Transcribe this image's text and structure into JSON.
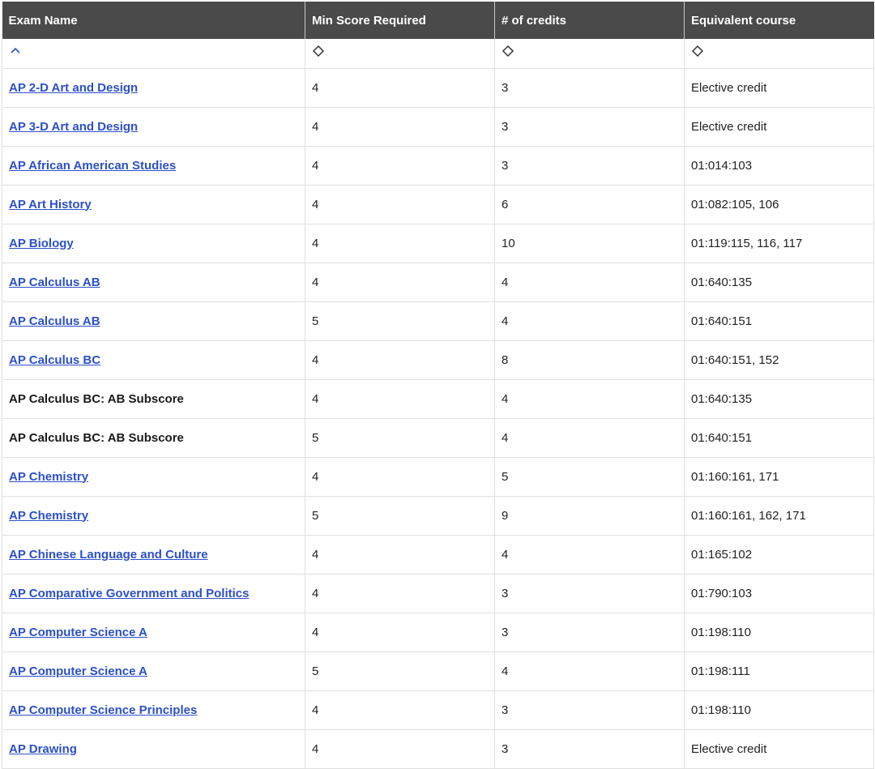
{
  "table": {
    "headers": {
      "exam_name": "Exam Name",
      "min_score": "Min Score Required",
      "credits": "# of credits",
      "equivalent": "Equivalent course"
    },
    "sort": {
      "exam_name": "ascending",
      "min_score": "unsorted",
      "credits": "unsorted",
      "equivalent": "unsorted"
    },
    "rows": [
      {
        "exam": "AP 2-D Art and Design",
        "link": true,
        "min_score": "4",
        "credits": "3",
        "equivalent": "Elective credit"
      },
      {
        "exam": "AP 3-D Art and Design",
        "link": true,
        "min_score": "4",
        "credits": "3",
        "equivalent": "Elective credit"
      },
      {
        "exam": "AP African American Studies",
        "link": true,
        "min_score": "4",
        "credits": "3",
        "equivalent": "01:014:103"
      },
      {
        "exam": "AP Art History",
        "link": true,
        "min_score": "4",
        "credits": "6",
        "equivalent": "01:082:105, 106"
      },
      {
        "exam": "AP Biology",
        "link": true,
        "min_score": "4",
        "credits": "10",
        "equivalent": "01:119:115, 116, 117"
      },
      {
        "exam": "AP Calculus AB",
        "link": true,
        "min_score": "4",
        "credits": "4",
        "equivalent": "01:640:135"
      },
      {
        "exam": "AP Calculus AB",
        "link": true,
        "min_score": "5",
        "credits": "4",
        "equivalent": "01:640:151"
      },
      {
        "exam": "AP Calculus BC",
        "link": true,
        "min_score": "4",
        "credits": "8",
        "equivalent": "01:640:151, 152"
      },
      {
        "exam": "AP Calculus BC: AB Subscore",
        "link": false,
        "min_score": "4",
        "credits": "4",
        "equivalent": "01:640:135"
      },
      {
        "exam": "AP Calculus BC: AB Subscore",
        "link": false,
        "min_score": "5",
        "credits": "4",
        "equivalent": "01:640:151"
      },
      {
        "exam": "AP Chemistry",
        "link": true,
        "min_score": "4",
        "credits": "5",
        "equivalent": "01:160:161, 171"
      },
      {
        "exam": "AP Chemistry",
        "link": true,
        "min_score": "5",
        "credits": "9",
        "equivalent": "01:160:161, 162, 171"
      },
      {
        "exam": "AP Chinese Language and Culture",
        "link": true,
        "min_score": "4",
        "credits": "4",
        "equivalent": "01:165:102"
      },
      {
        "exam": "AP Comparative Government and Politics",
        "link": true,
        "min_score": "4",
        "credits": "3",
        "equivalent": "01:790:103"
      },
      {
        "exam": "AP Computer Science A",
        "link": true,
        "min_score": "4",
        "credits": "3",
        "equivalent": "01:198:110"
      },
      {
        "exam": "AP Computer Science A",
        "link": true,
        "min_score": "5",
        "credits": "4",
        "equivalent": "01:198:111"
      },
      {
        "exam": "AP Computer Science Principles",
        "link": true,
        "min_score": "4",
        "credits": "3",
        "equivalent": "01:198:110"
      },
      {
        "exam": "AP Drawing",
        "link": true,
        "min_score": "4",
        "credits": "3",
        "equivalent": "Elective credit"
      }
    ]
  },
  "colors": {
    "header_bg": "#4a4a4a",
    "header_text": "#ffffff",
    "link": "#2c50c8",
    "sort_active": "#2c50c8",
    "sort_inactive": "#333333",
    "grid": "#e0e0e0"
  }
}
